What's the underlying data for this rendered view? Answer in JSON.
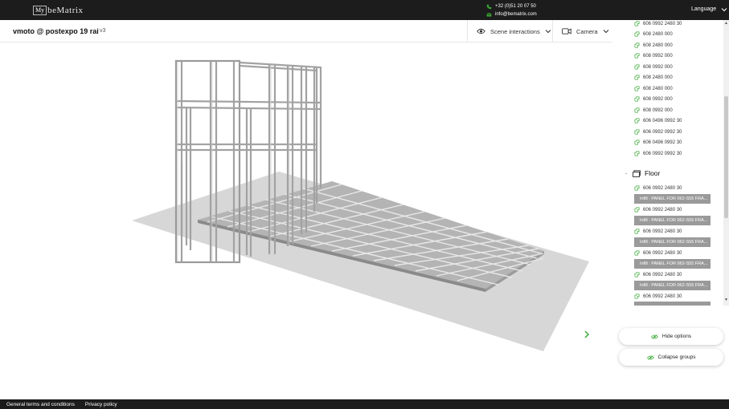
{
  "topbar": {
    "logo_box": "My",
    "logo_text": "beMatrix",
    "phone": "+32 (0)51 20 07 50",
    "email": "info@bematrix.com",
    "language_label": "Language"
  },
  "header": {
    "project_title": "vmoto @ postexpo 19 rai",
    "version": "v3",
    "scene_interactions_label": "Scene interactions",
    "camera_label": "Camera"
  },
  "tree": {
    "items": [
      {
        "label": "606 0992 2480 30"
      },
      {
        "label": "608 2480 000"
      },
      {
        "label": "608 2480 000"
      },
      {
        "label": "608 0992 000"
      },
      {
        "label": "608 0992 000"
      },
      {
        "label": "608 2480 000"
      },
      {
        "label": "608 2480 000"
      },
      {
        "label": "608 0992 000"
      },
      {
        "label": "608 0992 000"
      },
      {
        "label": "606 0496 0992 30"
      },
      {
        "label": "606 0992 0992 30"
      },
      {
        "label": "606 0496 0992 30"
      },
      {
        "label": "606 0992 0992 30"
      }
    ],
    "group": {
      "label": "Floor"
    },
    "floor_items": [
      {
        "label": "606 0992 2480 30",
        "infill": "Infill : PANEL FOR 062-S55 FRA..."
      },
      {
        "label": "606 0992 2480 30",
        "infill": "Infill : PANEL FOR 062-S55 FRA..."
      },
      {
        "label": "606 0992 2480 30",
        "infill": "Infill : PANEL FOR 062-S55 FRA..."
      },
      {
        "label": "606 0992 2480 30",
        "infill": "Infill : PANEL FOR 062-S55 FRA..."
      },
      {
        "label": "606 0992 2480 30",
        "infill": "Infill : PANEL FOR 062-S55 FRA..."
      },
      {
        "label": "606 0992 2480 30",
        "infill": ""
      }
    ]
  },
  "panel_buttons": {
    "hide_options": "Hide options",
    "collapse_groups": "Collapse groups"
  },
  "footer": {
    "terms": "General terms and conditions",
    "privacy": "Privacy policy"
  },
  "colors": {
    "topbar_bg": "#1c1c1c",
    "accent_green": "#3aa935",
    "infill_bg": "#9a9a9a",
    "floor_gray": "#d7d7d7"
  }
}
